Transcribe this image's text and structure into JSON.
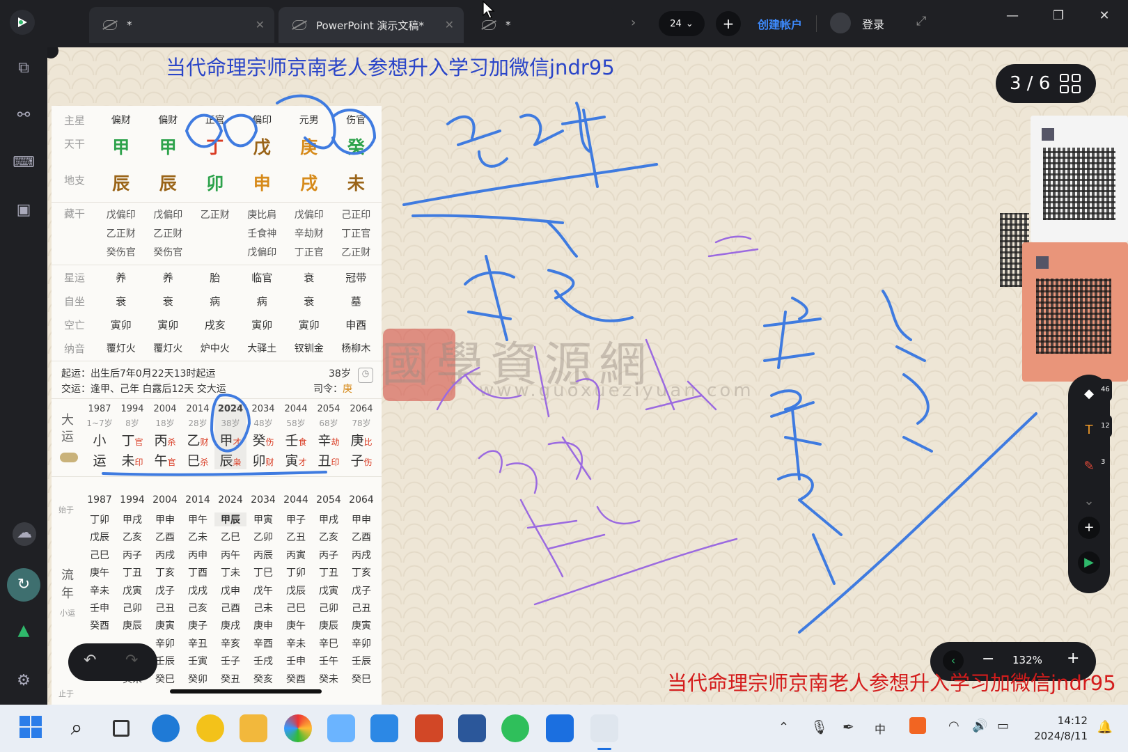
{
  "tabs": [
    {
      "label": "*"
    },
    {
      "label": "PowerPoint 演示文稿*"
    },
    {
      "label": "*"
    }
  ],
  "toolbar": {
    "page_count": "24",
    "create_account": "创建帐户",
    "login": "登录"
  },
  "slide": {
    "headline": "当代命理宗师京南老人参想升入学习加微信jndr95",
    "footline": "当代命理宗师京南老人参想升入学习加微信jndr95",
    "page_indicator": "3 / 6",
    "zoom": "132%"
  },
  "watermark": {
    "title": "國學資源網",
    "url": "www.guoxueziyuan.com"
  },
  "bazi": {
    "row_labels": [
      "主星",
      "天干",
      "地支",
      "藏干",
      "星运",
      "自坐",
      "空亡",
      "纳音"
    ],
    "zhuxing": [
      "偏财",
      "偏财",
      "正官",
      "偏印",
      "元男",
      "伤官"
    ],
    "tiangan": [
      "甲",
      "甲",
      "丁",
      "戊",
      "庚",
      "癸"
    ],
    "dizhi": [
      "辰",
      "辰",
      "卯",
      "申",
      "戌",
      "未"
    ],
    "canggan": [
      [
        "戊偏印",
        "乙正财",
        "癸伤官"
      ],
      [
        "戊偏印",
        "乙正财",
        "癸伤官"
      ],
      [
        "乙正财",
        "",
        ""
      ],
      [
        "庚比肩",
        "壬食神",
        "戊偏印"
      ],
      [
        "戊偏印",
        "辛劫财",
        "丁正官"
      ],
      [
        "己正印",
        "丁正官",
        "乙正财"
      ]
    ],
    "xingyun": [
      "养",
      "养",
      "胎",
      "临官",
      "衰",
      "冠带"
    ],
    "zizuo": [
      "衰",
      "衰",
      "病",
      "病",
      "衰",
      "墓"
    ],
    "kongwang": [
      "寅卯",
      "寅卯",
      "戌亥",
      "寅卯",
      "寅卯",
      "申酉"
    ],
    "nayin": [
      "覆灯火",
      "覆灯火",
      "炉中火",
      "大驿土",
      "钗钏金",
      "杨柳木"
    ],
    "qiyun": "起运：出生后7年0月22天13时起运",
    "qiyun_age": "38岁",
    "jiaoyun": "交运：逢甲、己年 白露后12天 交大运",
    "siling_label": "司令：",
    "siling_value": "庚",
    "dayun_label": [
      "大",
      "运"
    ],
    "dayun": [
      {
        "year": "1987",
        "age": "1~7岁",
        "top": "小",
        "bot": "运",
        "t2": "",
        "b2": ""
      },
      {
        "year": "1994",
        "age": "8岁",
        "top": "丁",
        "bot": "未",
        "t2": "官",
        "b2": "印"
      },
      {
        "year": "2004",
        "age": "18岁",
        "top": "丙",
        "bot": "午",
        "t2": "杀",
        "b2": "官"
      },
      {
        "year": "2014",
        "age": "28岁",
        "top": "乙",
        "bot": "巳",
        "t2": "财",
        "b2": "杀"
      },
      {
        "year": "2024",
        "age": "38岁",
        "top": "甲",
        "bot": "辰",
        "t2": "才",
        "b2": "枭"
      },
      {
        "year": "2034",
        "age": "48岁",
        "top": "癸",
        "bot": "卯",
        "t2": "伤",
        "b2": "财"
      },
      {
        "year": "2044",
        "age": "58岁",
        "top": "壬",
        "bot": "寅",
        "t2": "食",
        "b2": "才"
      },
      {
        "year": "2054",
        "age": "68岁",
        "top": "辛",
        "bot": "丑",
        "t2": "劫",
        "b2": "印"
      },
      {
        "year": "2064",
        "age": "78岁",
        "top": "庚",
        "bot": "子",
        "t2": "比",
        "b2": "伤"
      }
    ],
    "liunian_label": [
      "流",
      "年"
    ],
    "shiyu": "始于",
    "xiaoyun": "小运",
    "zhiyu": "止于",
    "liunian_years": [
      "1987",
      "1994",
      "2004",
      "2014",
      "2024",
      "2034",
      "2044",
      "2054",
      "2064"
    ],
    "liunian": [
      [
        "丁卯",
        "甲戌",
        "甲申",
        "甲午",
        "甲辰",
        "甲寅",
        "甲子",
        "甲戌",
        "甲申"
      ],
      [
        "戊辰",
        "乙亥",
        "乙酉",
        "乙未",
        "乙巳",
        "乙卯",
        "乙丑",
        "乙亥",
        "乙酉"
      ],
      [
        "己巳",
        "丙子",
        "丙戌",
        "丙申",
        "丙午",
        "丙辰",
        "丙寅",
        "丙子",
        "丙戌"
      ],
      [
        "庚午",
        "丁丑",
        "丁亥",
        "丁酉",
        "丁未",
        "丁巳",
        "丁卯",
        "丁丑",
        "丁亥"
      ],
      [
        "辛未",
        "戊寅",
        "戊子",
        "戊戌",
        "戊申",
        "戊午",
        "戊辰",
        "戊寅",
        "戊子"
      ],
      [
        "壬申",
        "己卯",
        "己丑",
        "己亥",
        "己酉",
        "己未",
        "己巳",
        "己卯",
        "己丑"
      ],
      [
        "癸酉",
        "庚辰",
        "庚寅",
        "庚子",
        "庚戌",
        "庚申",
        "庚午",
        "庚辰",
        "庚寅"
      ],
      [
        "",
        "",
        "辛卯",
        "辛丑",
        "辛亥",
        "辛酉",
        "辛未",
        "辛巳",
        "辛卯"
      ],
      [
        "",
        "",
        "壬辰",
        "壬寅",
        "壬子",
        "壬戌",
        "壬申",
        "壬午",
        "壬辰"
      ],
      [
        "",
        "癸未",
        "癸巳",
        "癸卯",
        "癸丑",
        "癸亥",
        "癸酉",
        "癸未",
        "癸巳"
      ]
    ]
  },
  "tools": {
    "eraser_count": "46",
    "text_count": "12",
    "pen_count": "3"
  },
  "clock": {
    "time": "14:12",
    "date": "2024/8/11"
  },
  "colors": {
    "ink_blue": "#3f7be0",
    "ink_purple": "#9b6ae0",
    "accent_blue": "#2a45c8",
    "accent_red": "#d41c1c"
  }
}
